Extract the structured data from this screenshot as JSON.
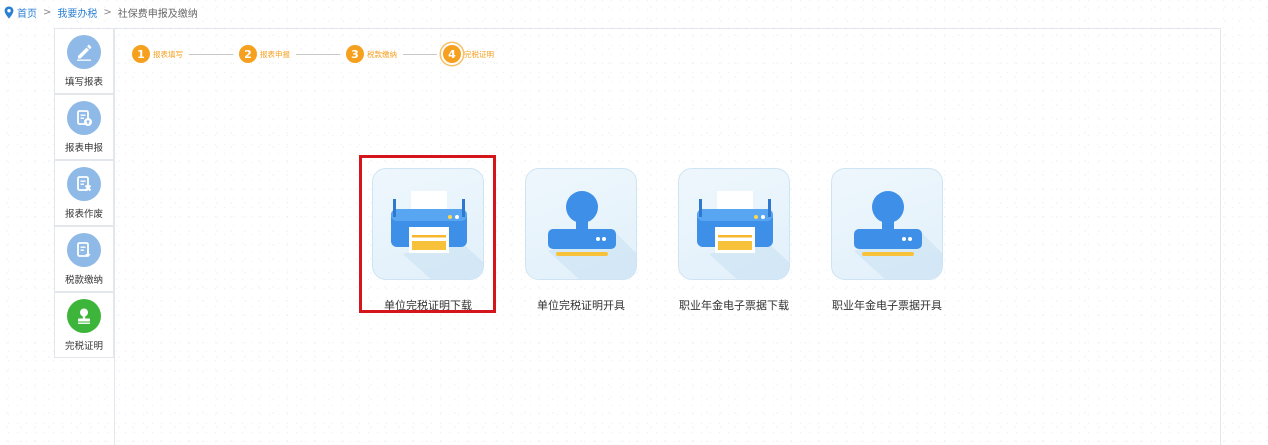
{
  "breadcrumb": {
    "home": "首页",
    "sep": ">",
    "level2": "我要办税",
    "current": "社保费申报及缴纳"
  },
  "sidenav": [
    {
      "label": "填写报表",
      "icon": "pen-icon"
    },
    {
      "label": "报表申报",
      "icon": "doc-upload-icon"
    },
    {
      "label": "报表作废",
      "icon": "doc-cancel-icon"
    },
    {
      "label": "税款缴纳",
      "icon": "doc-download-icon"
    },
    {
      "label": "完税证明",
      "icon": "stamp-icon",
      "active": true
    }
  ],
  "steps": [
    {
      "num": "1",
      "label": "报表填写"
    },
    {
      "num": "2",
      "label": "报表申报"
    },
    {
      "num": "3",
      "label": "税款缴纳"
    },
    {
      "num": "4",
      "label": "完税证明",
      "current": true
    }
  ],
  "cards": [
    {
      "label": "单位完税证明下载",
      "icon": "printer-icon",
      "selected": true
    },
    {
      "label": "单位完税证明开具",
      "icon": "stamp-icon"
    },
    {
      "label": "职业年金电子票据下载",
      "icon": "printer-icon"
    },
    {
      "label": "职业年金电子票据开具",
      "icon": "stamp-icon"
    }
  ],
  "colors": {
    "step_orange": "#f5a01e",
    "nav_blue": "#8fb9e6",
    "nav_active_green": "#3db53a",
    "highlight_red": "#d4161c",
    "link_blue": "#2a7fd4"
  }
}
